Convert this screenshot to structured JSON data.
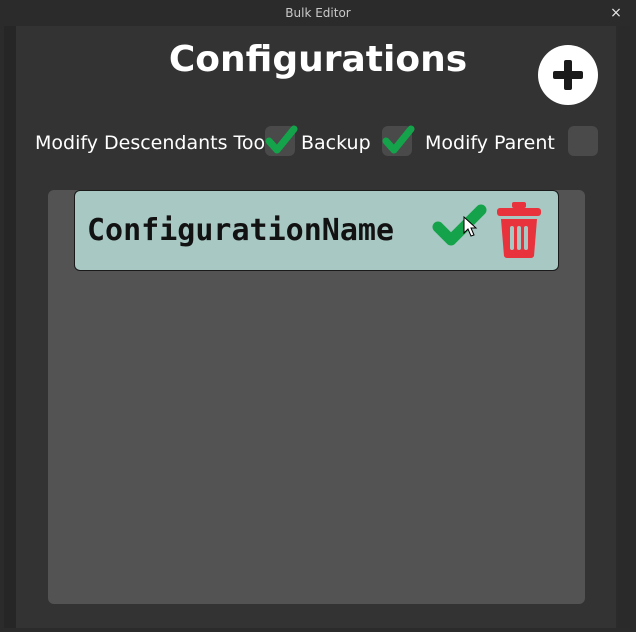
{
  "window": {
    "title": "Bulk Editor",
    "close_label": "×"
  },
  "header": {
    "title": "Configurations",
    "add_button_icon": "plus-icon"
  },
  "options": [
    {
      "label": "Modify Descendants Too",
      "checked": true
    },
    {
      "label": "Backup",
      "checked": true
    },
    {
      "label": "Modify Parent",
      "checked": false
    }
  ],
  "configurations": [
    {
      "name": "ConfigurationName",
      "enabled": true
    }
  ],
  "colors": {
    "check_green": "#14a34a",
    "trash_red": "#e8323c",
    "item_bg": "#a8c8c3",
    "panel_bg": "#333333",
    "list_bg": "#535353"
  }
}
